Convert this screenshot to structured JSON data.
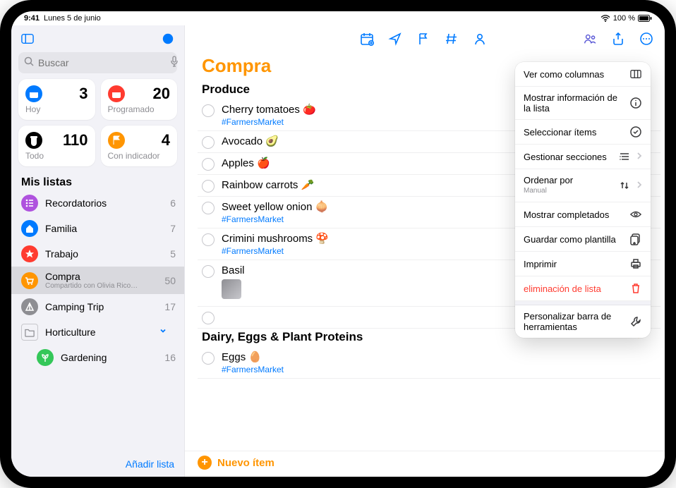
{
  "statusbar": {
    "time": "9:41",
    "date": "Lunes 5 de junio",
    "battery": "100 %"
  },
  "sidebar": {
    "search_placeholder": "Buscar",
    "add_list": "Añadir lista",
    "smart": [
      {
        "label": "Hoy",
        "count": 3,
        "bg": "#007aff"
      },
      {
        "label": "Programado",
        "count": 20,
        "bg": "#ff3b30"
      },
      {
        "label": "Todo",
        "count": 110,
        "bg": "#000000"
      },
      {
        "label": "Con indicador",
        "count": 4,
        "bg": "#ff9500"
      }
    ],
    "heading": "Mis listas",
    "lists": [
      {
        "name": "Recordatorios",
        "count": 6,
        "bg": "#af52de"
      },
      {
        "name": "Familia",
        "count": 7,
        "bg": "#007aff"
      },
      {
        "name": "Trabajo",
        "count": 5,
        "bg": "#ff3b30"
      },
      {
        "name": "Compra",
        "count": 50,
        "bg": "#ff9500",
        "sub": "Compartido con Olivia Rico…",
        "selected": true
      },
      {
        "name": "Camping Trip",
        "count": 17,
        "bg": "#8e8e93"
      },
      {
        "name": "Horticulture",
        "count": "",
        "bg": "#ffffff",
        "folder": true,
        "disclosure": true
      },
      {
        "name": "Gardening",
        "count": 16,
        "bg": "#34c759",
        "child": true
      }
    ]
  },
  "content": {
    "title": "Compra",
    "accent": "#ff9500",
    "new_item": "Nuevo ítem",
    "sections": [
      {
        "title": "Produce",
        "items": [
          {
            "title": "Cherry tomatoes 🍅",
            "tag": "#FarmersMarket"
          },
          {
            "title": "Avocado 🥑"
          },
          {
            "title": "Apples 🍎"
          },
          {
            "title": "Rainbow carrots 🥕"
          },
          {
            "title": "Sweet yellow onion 🧅",
            "tag": "#FarmersMarket"
          },
          {
            "title": "Crimini mushrooms 🍄",
            "tag": "#FarmersMarket"
          },
          {
            "title": "Basil",
            "thumb": true
          }
        ],
        "show_empty_row": true
      },
      {
        "title": "Dairy, Eggs & Plant Proteins",
        "collapsible": true,
        "items": [
          {
            "title": "Eggs 🥚",
            "tag": "#FarmersMarket"
          }
        ]
      }
    ]
  },
  "popover": {
    "items": [
      {
        "label": "Ver como columnas",
        "icon": "columns"
      },
      {
        "label": "Mostrar información de la lista",
        "icon": "info"
      },
      {
        "label": "Seleccionar ítems",
        "icon": "select"
      },
      {
        "label": "Gestionar secciones",
        "icon": "sections",
        "chevron": true
      },
      {
        "label": "Ordenar por",
        "sub": "Manual",
        "icon": "sort",
        "chevron": true
      },
      {
        "label": "Mostrar completados",
        "icon": "eye"
      },
      {
        "label": "Guardar como plantilla",
        "icon": "template"
      },
      {
        "label": "Imprimir",
        "icon": "printer"
      },
      {
        "label": "eliminación de lista",
        "icon": "trash",
        "destructive": true
      },
      {
        "separator": true
      },
      {
        "label": "Personalizar barra de herramientas",
        "icon": "wrench"
      }
    ]
  }
}
